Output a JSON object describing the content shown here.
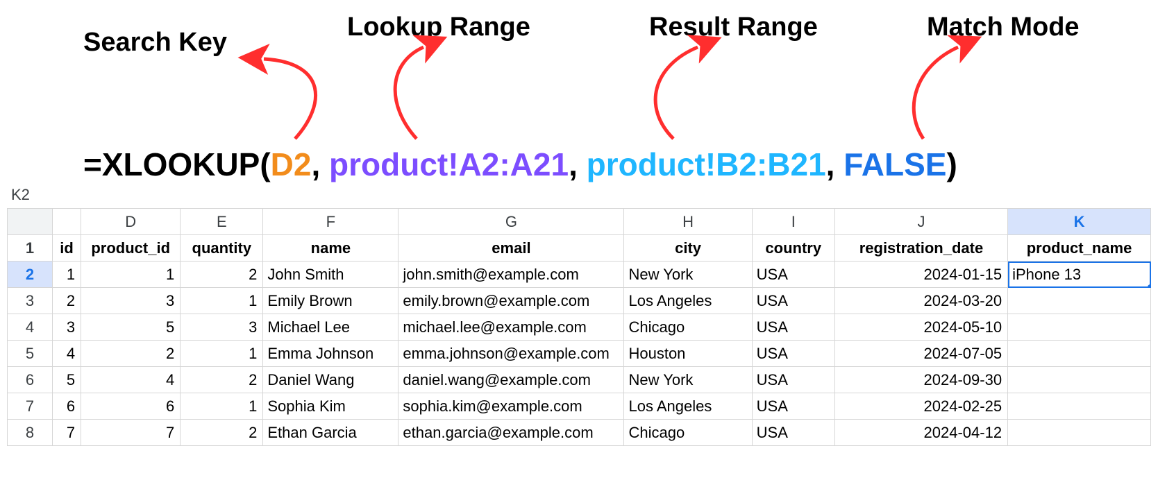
{
  "annotations": {
    "search_key": "Search Key",
    "lookup_range": "Lookup Range",
    "result_range": "Result Range",
    "match_mode": "Match Mode"
  },
  "formula": {
    "prefix": "=XLOOKUP(",
    "arg1": "D2",
    "sep": ", ",
    "arg2": "product!A2:A21",
    "arg3": "product!B2:B21",
    "arg4": "FALSE",
    "suffix": ")"
  },
  "cell_reference": "K2",
  "columns": {
    "partial": "id",
    "D": "D",
    "E": "E",
    "F": "F",
    "G": "G",
    "H": "H",
    "I": "I",
    "J": "J",
    "K": "K"
  },
  "headers": {
    "partial": "id",
    "D": "product_id",
    "E": "quantity",
    "F": "name",
    "G": "email",
    "H": "city",
    "I": "country",
    "J": "registration_date",
    "K": "product_name"
  },
  "rows": [
    {
      "n": "1"
    },
    {
      "n": "2",
      "id": "1",
      "D": "1",
      "E": "2",
      "F": "John Smith",
      "G": "john.smith@example.com",
      "H": "New York",
      "I": "USA",
      "J": "2024-01-15",
      "K": "iPhone 13"
    },
    {
      "n": "3",
      "id": "2",
      "D": "3",
      "E": "1",
      "F": "Emily Brown",
      "G": "emily.brown@example.com",
      "H": "Los Angeles",
      "I": "USA",
      "J": "2024-03-20",
      "K": ""
    },
    {
      "n": "4",
      "id": "3",
      "D": "5",
      "E": "3",
      "F": "Michael Lee",
      "G": "michael.lee@example.com",
      "H": "Chicago",
      "I": "USA",
      "J": "2024-05-10",
      "K": ""
    },
    {
      "n": "5",
      "id": "4",
      "D": "2",
      "E": "1",
      "F": "Emma Johnson",
      "G": "emma.johnson@example.com",
      "H": "Houston",
      "I": "USA",
      "J": "2024-07-05",
      "K": ""
    },
    {
      "n": "6",
      "id": "5",
      "D": "4",
      "E": "2",
      "F": "Daniel Wang",
      "G": "daniel.wang@example.com",
      "H": "New York",
      "I": "USA",
      "J": "2024-09-30",
      "K": ""
    },
    {
      "n": "7",
      "id": "6",
      "D": "6",
      "E": "1",
      "F": "Sophia Kim",
      "G": "sophia.kim@example.com",
      "H": "Los Angeles",
      "I": "USA",
      "J": "2024-02-25",
      "K": ""
    },
    {
      "n": "8",
      "id": "7",
      "D": "7",
      "E": "2",
      "F": "Ethan Garcia",
      "G": "ethan.garcia@example.com",
      "H": "Chicago",
      "I": "USA",
      "J": "2024-04-12",
      "K": ""
    }
  ],
  "colors": {
    "arrow": "#ff2e2e"
  }
}
